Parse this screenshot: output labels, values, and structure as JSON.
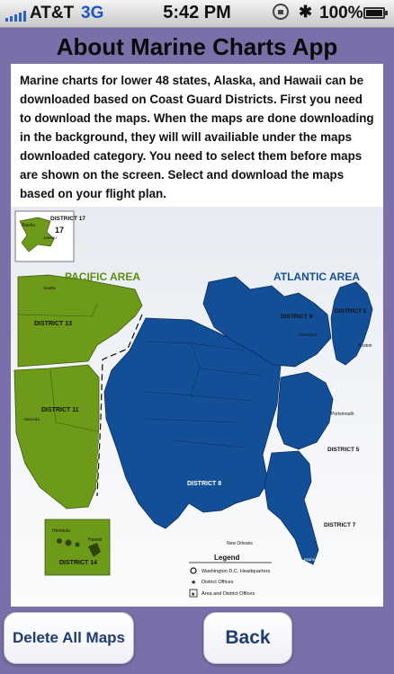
{
  "status_bar": {
    "carrier": "AT&T",
    "network": "3G",
    "time": "5:42 PM",
    "battery_percent": "100%"
  },
  "page": {
    "title": "About Marine Charts App",
    "description": "Marine charts for lower 48 states, Alaska, and Hawaii can be downloaded based on Coast Guard Districts.  First you need to download the maps.  When the maps are done downloading in the background, they will will availiable under the maps downloaded category.  You need to select them before maps are shown on the screen.  Select and download the maps based on your flight plan."
  },
  "map": {
    "pacific_label": "PACIFIC AREA",
    "atlantic_label": "ATLANTIC AREA",
    "districts": {
      "d17": "DISTRICT 17",
      "d13": "DISTRICT 13",
      "d11": "DISTRICT 11",
      "d14": "DISTRICT 14",
      "d9": "DISTRICT 9",
      "d1": "DISTRICT 1",
      "d5": "DISTRICT 5",
      "d8": "DISTRICT 8",
      "d7": "DISTRICT 7"
    },
    "cities": {
      "alameda": "Alameda",
      "honolulu": "Honolulu",
      "hawaii": "Hawaii",
      "boston": "Boston",
      "portsmouth": "Portsmouth",
      "new_orleans": "New Orleans",
      "cleveland": "Cleveland",
      "miami": "Miami",
      "seattle": "Seattle",
      "juneau": "Juneau",
      "alaska": "Alaska"
    },
    "legend": {
      "title": "Legend",
      "items": [
        "Washington D.C. Headquarters",
        "District Offices",
        "Area and District Offices"
      ]
    },
    "colors": {
      "pacific": "#6e9a1a",
      "atlantic": "#134f96",
      "label_green": "#5d8d10"
    }
  },
  "buttons": {
    "delete_all": "Delete All Maps",
    "back": "Back"
  }
}
